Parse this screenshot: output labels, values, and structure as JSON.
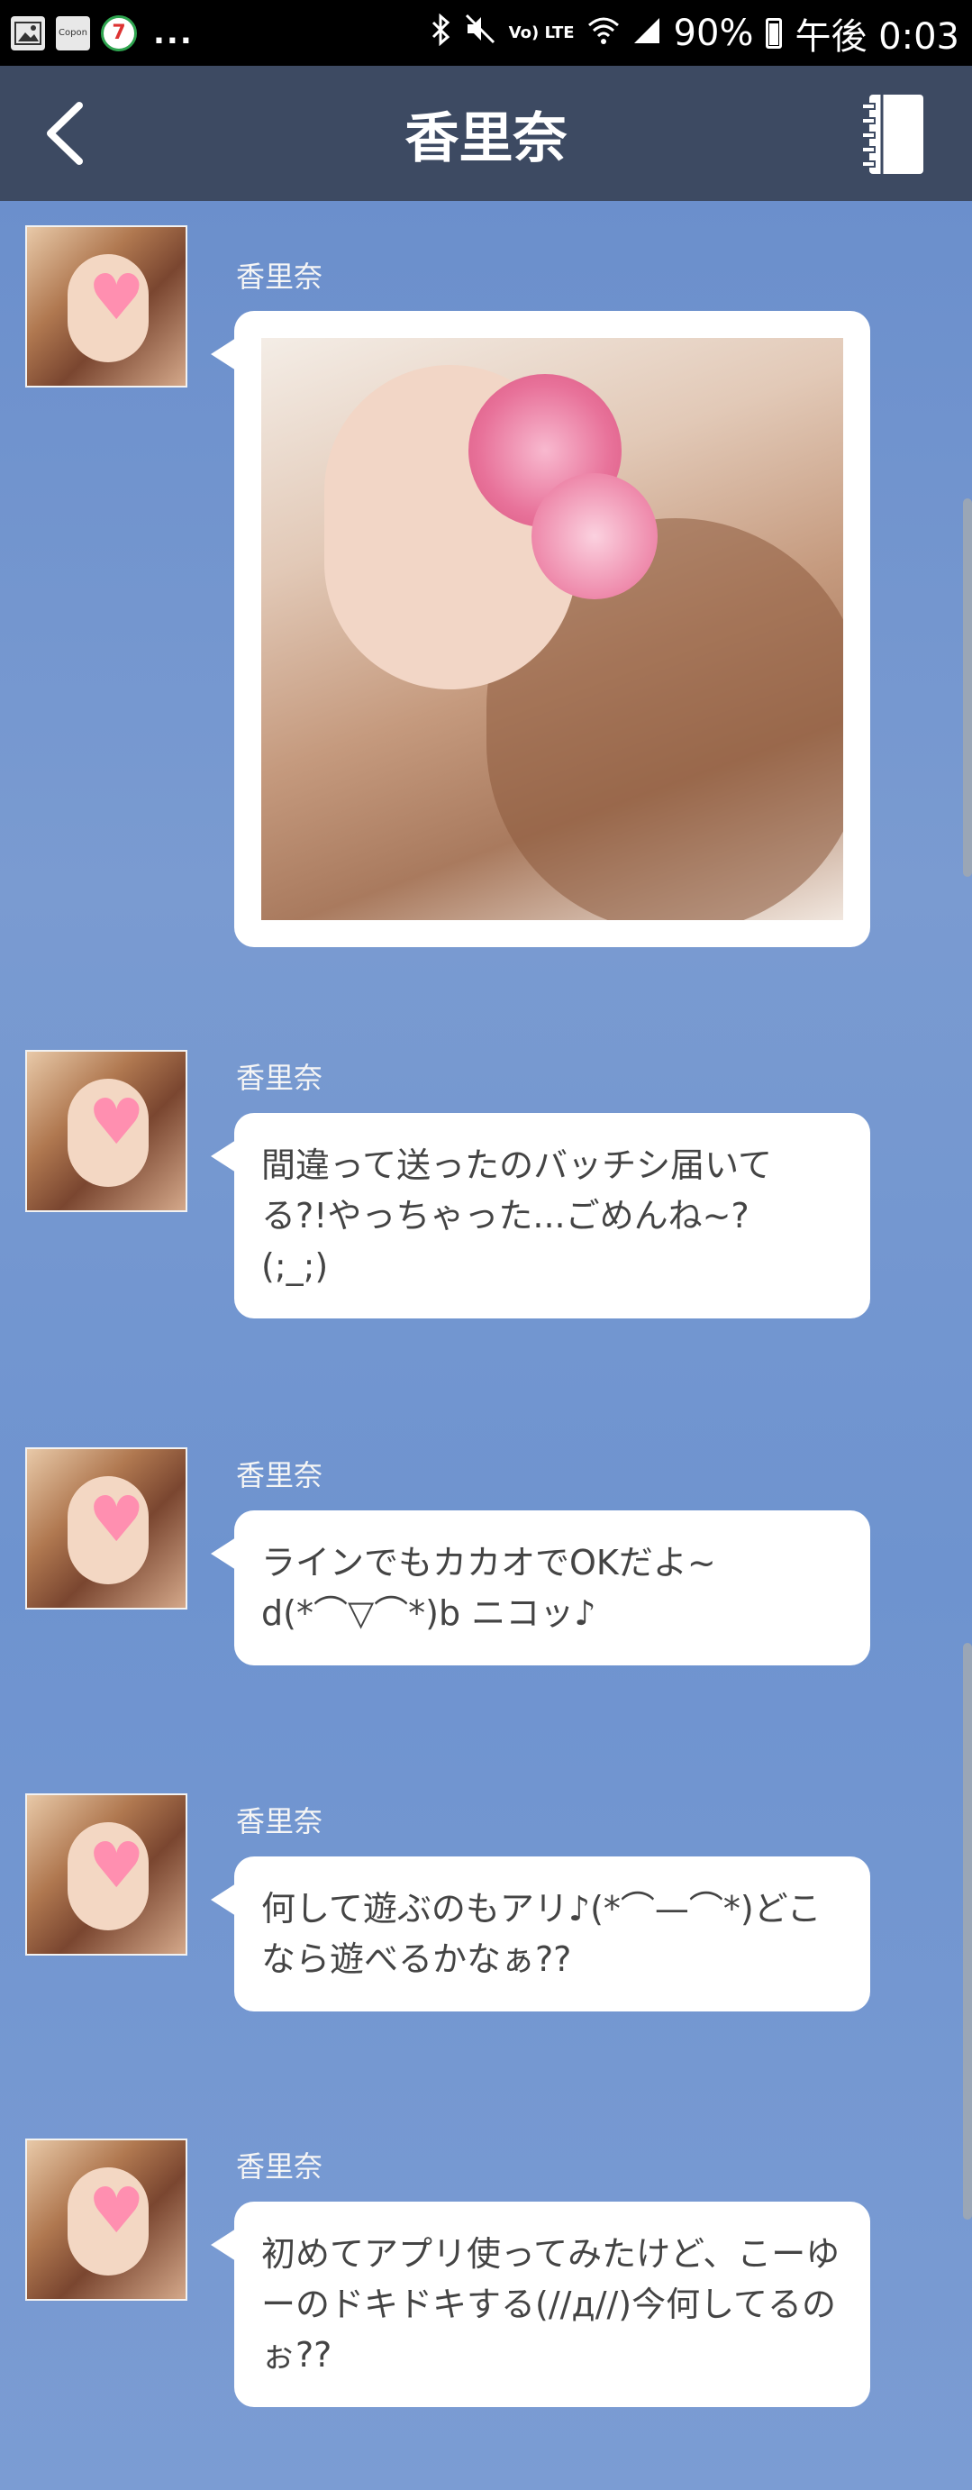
{
  "status_bar": {
    "left_icons": [
      "image-icon",
      "coupon-icon",
      "seven-eleven-icon"
    ],
    "coupon_text": "Copon",
    "seven_text": "7",
    "more": "...",
    "battery": "90%",
    "clock": "午後 0:03",
    "network": "Vo) LTE"
  },
  "header": {
    "title": "香里奈",
    "back_icon": "chevron-left-icon",
    "book_icon": "address-book-icon",
    "background": "#3d4a62"
  },
  "messages": [
    {
      "sender": "香里奈",
      "type": "image",
      "lines": []
    },
    {
      "sender": "香里奈",
      "type": "text",
      "lines": [
        "間違って送ったのバッチシ届いて",
        "る?!やっちゃった...ごめんね~?",
        "(;_;)"
      ]
    },
    {
      "sender": "香里奈",
      "type": "text",
      "lines": [
        "ラインでもカカオでOKだよ~",
        "d(*⌒▽⌒*)b ニコッ♪"
      ]
    },
    {
      "sender": "香里奈",
      "type": "text",
      "lines": [
        "何して遊ぶのもアリ♪(*⌒—⌒*)どこ",
        "なら遊べるかなぁ??"
      ]
    },
    {
      "sender": "香里奈",
      "type": "text",
      "lines": [
        "初めてアプリ使ってみたけど、こーゆ",
        "ーのドキドキする(//д//)今何してるの",
        "ぉ??"
      ]
    }
  ],
  "colors": {
    "chat_background": "#6f95cf",
    "bubble": "#ffffff",
    "text": "#444444"
  }
}
